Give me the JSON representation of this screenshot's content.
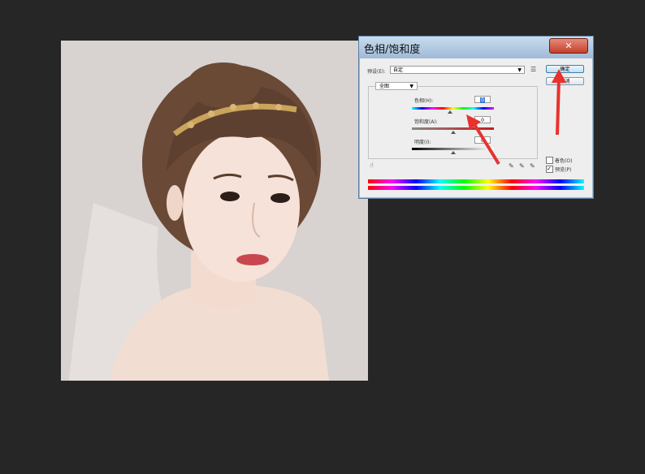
{
  "dialog": {
    "title": "色相/饱和度",
    "close_label": "✕",
    "preset_label": "预设(E):",
    "preset_value": "自定",
    "ok_label": "确定",
    "cancel_label": "取消",
    "channel_value": "全图",
    "hue_label": "色相(H):",
    "hue_value": "0",
    "saturation_label": "饱和度(A):",
    "saturation_value": "0",
    "lightness_label": "明度(I):",
    "lightness_value": "0",
    "colorize_label": "着色(O)",
    "colorize_checked": false,
    "preview_label": "预览(P)",
    "preview_checked": true
  },
  "annotations": {
    "arrow_color": "#e8322d"
  },
  "icons": [
    "preset-options-icon",
    "hand-adjust-icon",
    "eyedropper-icon",
    "eyedropper-plus-icon",
    "eyedropper-minus-icon",
    "close-icon"
  ]
}
